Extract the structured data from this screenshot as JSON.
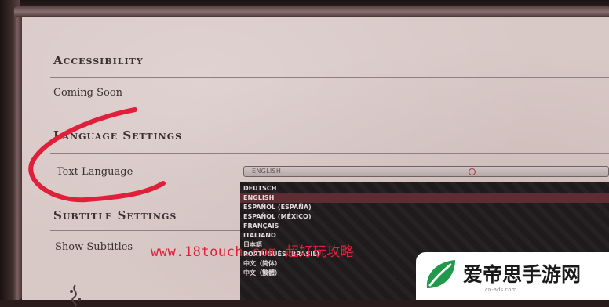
{
  "accessibility": {
    "title": "Accessibility",
    "coming_soon": "Coming Soon"
  },
  "language_settings": {
    "title": "Language Settings",
    "text_language_label": "Text Language",
    "selected_value": "ENGLISH",
    "options": [
      "DEUTSCH",
      "ENGLISH",
      "ESPAÑOL (ESPAÑA)",
      "ESPAÑOL (MÉXICO)",
      "FRANÇAIS",
      "ITALIANO",
      "日本語",
      "PORTUGUÊS (BRASIL)",
      "中文（简体）",
      "中文（繁體）"
    ],
    "selected_index": 1
  },
  "subtitle_settings": {
    "title": "Subtitle Settings",
    "show_subtitles_label": "Show Subtitles"
  },
  "watermark": {
    "url": "www.18touch.com 超好玩攻略",
    "brand": "爱帝思手游网",
    "site": "cn-ads.com"
  },
  "colors": {
    "accent": "#5e2c33",
    "annotation": "#e0203a",
    "panel": "#d8c8c6"
  }
}
